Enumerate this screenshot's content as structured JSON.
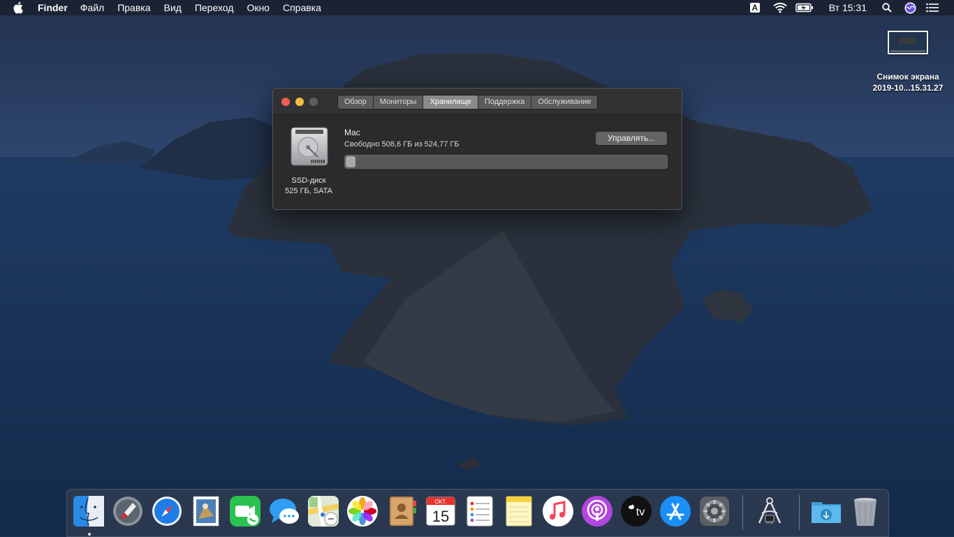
{
  "menubar": {
    "app_name": "Finder",
    "items": [
      "Файл",
      "Правка",
      "Вид",
      "Переход",
      "Окно",
      "Справка"
    ],
    "input_source": "A",
    "clock": "Вт 15:31",
    "icons": [
      "apple-icon",
      "wifi-icon",
      "battery-icon",
      "spotlight-icon",
      "siri-icon",
      "notification-center-icon"
    ]
  },
  "desktop": {
    "file": {
      "name_line1": "Снимок экрана",
      "name_line2": "2019-10...15.31.27"
    }
  },
  "window": {
    "tabs": [
      "Обзор",
      "Мониторы",
      "Хранилище",
      "Поддержка",
      "Обслуживание"
    ],
    "active_tab": "Хранилище",
    "disk": {
      "type": "SSD-диск",
      "spec": "525 ГБ, SATA"
    },
    "volume": {
      "name": "Mac",
      "free_text": "Свободно 508,6 ГБ из 524,77 ГБ",
      "used_fraction": 0.031
    },
    "manage_button": "Управлять..."
  },
  "dock": {
    "items": [
      {
        "name": "finder",
        "running": true
      },
      {
        "name": "launchpad"
      },
      {
        "name": "safari"
      },
      {
        "name": "mail"
      },
      {
        "name": "facetime"
      },
      {
        "name": "messages"
      },
      {
        "name": "maps"
      },
      {
        "name": "photos"
      },
      {
        "name": "contacts"
      },
      {
        "name": "calendar"
      },
      {
        "name": "reminders"
      },
      {
        "name": "notes"
      },
      {
        "name": "music"
      },
      {
        "name": "podcasts"
      },
      {
        "name": "tv"
      },
      {
        "name": "app-store"
      },
      {
        "name": "system-preferences"
      },
      {
        "name": "system-information"
      },
      {
        "name": "downloads"
      },
      {
        "name": "trash"
      }
    ],
    "calendar_month": "ОКТ.",
    "calendar_day": "15",
    "tv_label": "tv"
  }
}
